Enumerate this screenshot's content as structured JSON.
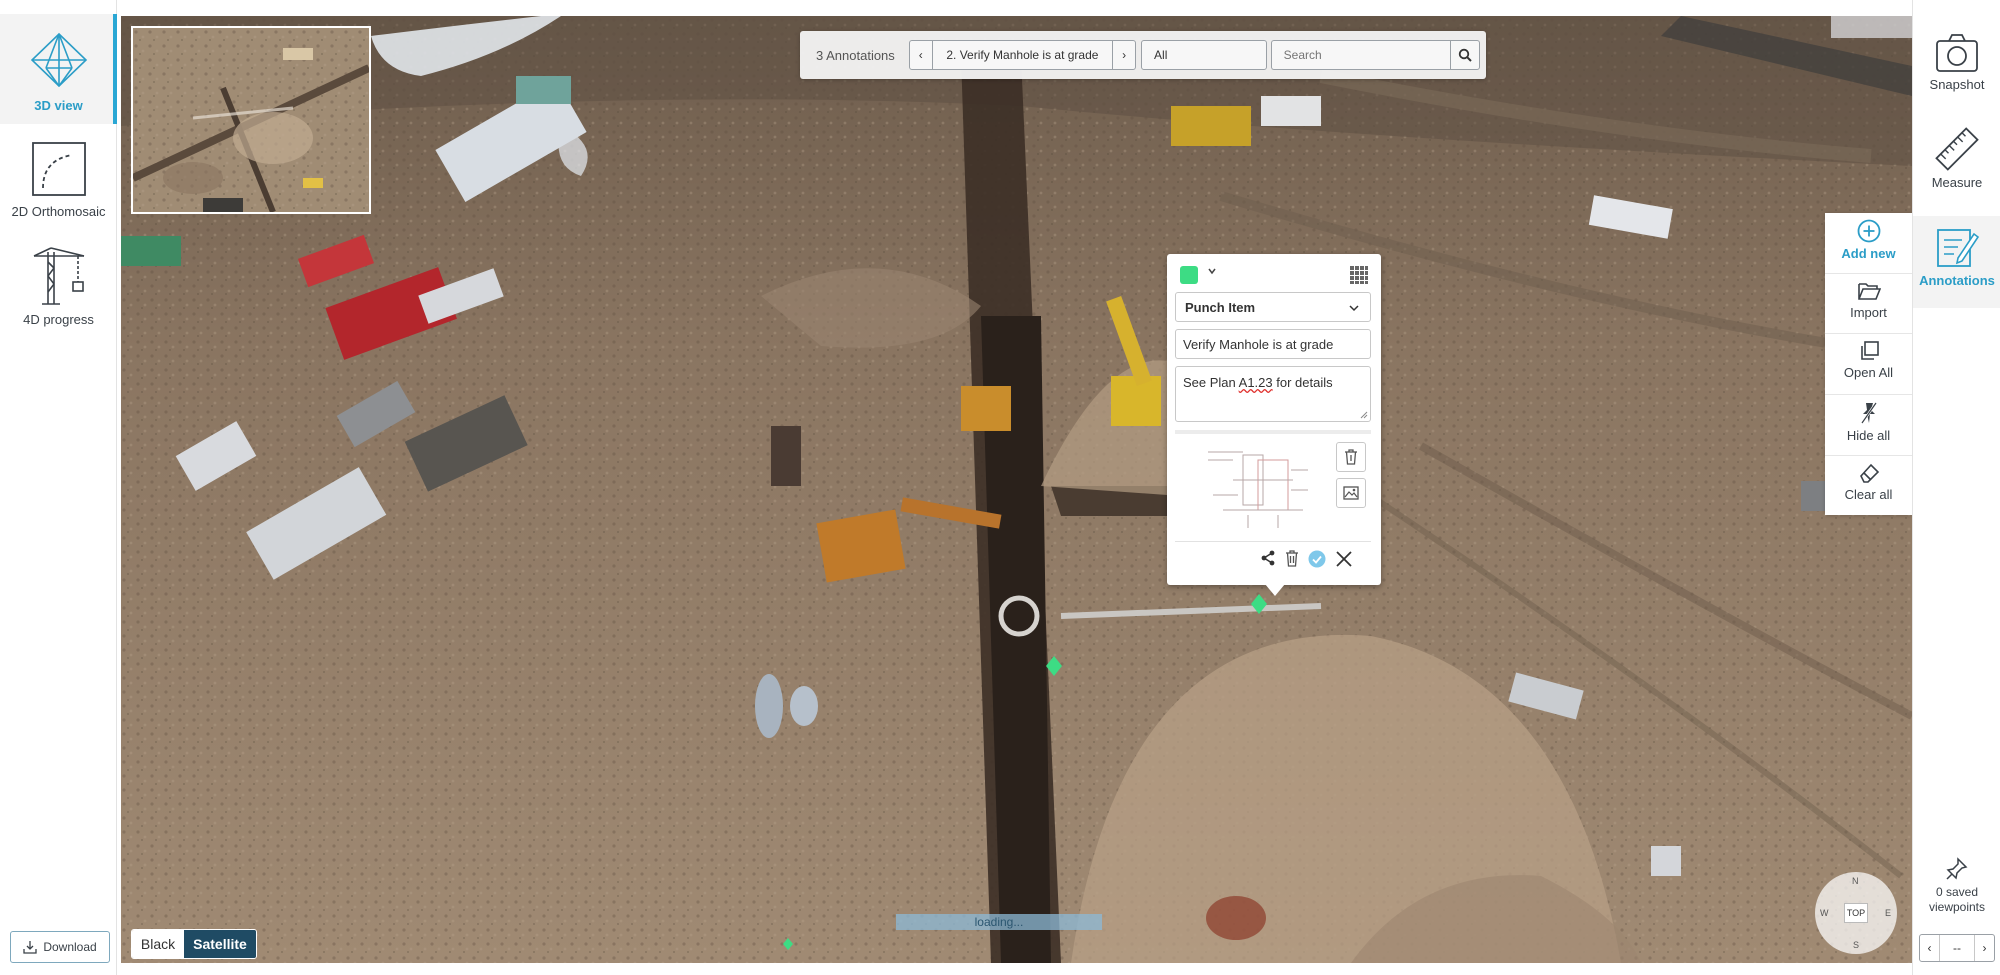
{
  "left_sidebar": {
    "items": [
      {
        "label": "3D view",
        "icon": "cube-wireframe-icon",
        "active": true
      },
      {
        "label": "2D Orthomosaic",
        "icon": "orthomosaic-icon",
        "active": false
      },
      {
        "label": "4D progress",
        "icon": "crane-icon",
        "active": false
      }
    ],
    "download_label": "Download"
  },
  "toolbar": {
    "annotation_count": "3 Annotations",
    "prev_label": "‹",
    "current_annotation": "2. Verify Manhole is at grade",
    "next_label": "›",
    "filter_value": "All",
    "search_placeholder": "Search"
  },
  "popup": {
    "color": "#3ddc84",
    "type_value": "Punch Item",
    "title_value": "Verify Manhole is at grade",
    "description_before": "See Plan ",
    "description_flagged": "A1.23",
    "description_after": " for details",
    "footer_icons": [
      "share-icon",
      "trash-icon",
      "confirm-icon",
      "close-icon"
    ]
  },
  "annotations_menu": {
    "items": [
      {
        "label": "Add new",
        "icon": "plus-circle-icon"
      },
      {
        "label": "Import",
        "icon": "folder-open-icon"
      },
      {
        "label": "Open All",
        "icon": "copy-icon"
      },
      {
        "label": "Hide all",
        "icon": "hide-icon"
      },
      {
        "label": "Clear all",
        "icon": "eraser-icon"
      }
    ]
  },
  "right_sidebar": {
    "items": [
      {
        "label": "Snapshot",
        "icon": "camera-icon",
        "active": false
      },
      {
        "label": "Measure",
        "icon": "ruler-icon",
        "active": false
      },
      {
        "label": "Annotations",
        "icon": "annotations-icon",
        "active": true
      }
    ],
    "saved_viewpoints_count": "0 saved",
    "saved_viewpoints_label": "viewpoints",
    "vp_prev": "‹",
    "vp_middle": "--",
    "vp_next": "›"
  },
  "basemap": {
    "black_label": "Black",
    "satellite_label": "Satellite"
  },
  "loading_text": "loading...",
  "compass": {
    "n": "N",
    "s": "S",
    "e": "E",
    "w": "W",
    "top_label": "TOP"
  },
  "colors": {
    "accent": "#2b9dc7",
    "satellite_active": "#1f4b64",
    "annotation_marker": "#3ddc84"
  }
}
